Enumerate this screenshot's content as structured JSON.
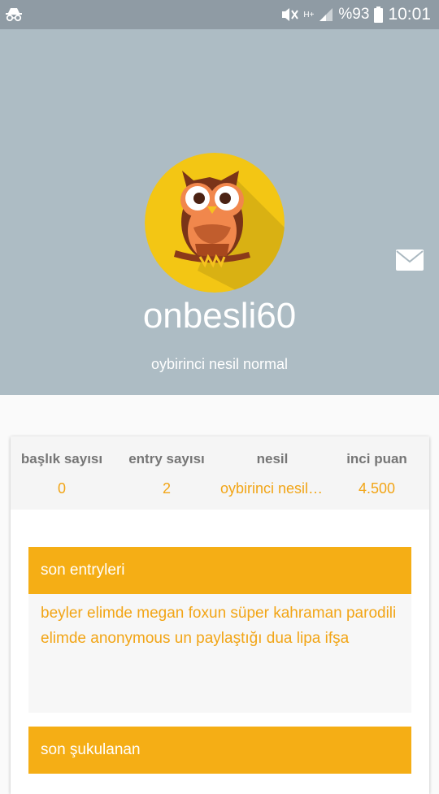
{
  "status_bar": {
    "battery_text": "%93",
    "time": "10:01",
    "network_type": "H+"
  },
  "profile": {
    "username": "onbesli60",
    "generation_text": "oybirinci nesil normal"
  },
  "stats": [
    {
      "label": "başlık sayısı",
      "value": "0"
    },
    {
      "label": "entry sayısı",
      "value": "2"
    },
    {
      "label": "nesil",
      "value": "oybirinci nesil normal"
    },
    {
      "label": "inci puan",
      "value": "4.500"
    }
  ],
  "sections": {
    "recent_entries_title": "son entryleri",
    "recent_entries": [
      "beyler elimde megan foxun süper kahraman parodili",
      "elimde anonymous un paylaştığı dua lipa ifşa"
    ],
    "liked_title": "son şukulanan"
  },
  "colors": {
    "header_bg": "#adbcc4",
    "accent": "#f5ae15",
    "avatar_bg": "#f3c614"
  }
}
